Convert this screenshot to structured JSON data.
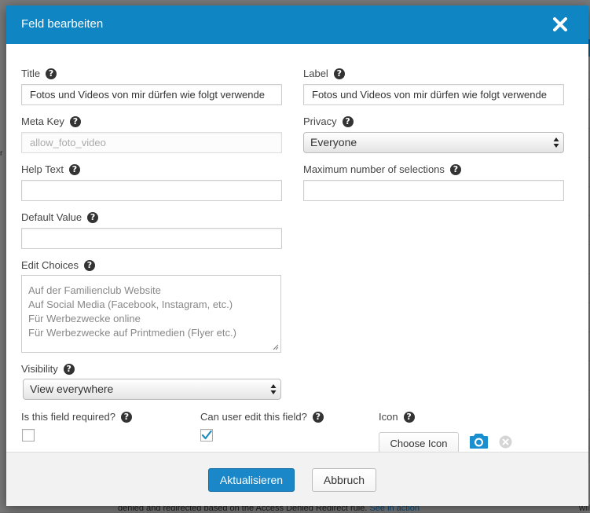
{
  "background": {
    "bottom_text": "denied and redirected based on the Access Denied Redirect rule.",
    "bottom_link": "See in action",
    "left_fragment": "r",
    "right_fragment": "will"
  },
  "modal": {
    "title": "Feld bearbeiten"
  },
  "form": {
    "title": {
      "label": "Title",
      "value": "Fotos und Videos von mir dürfen wie folgt verwende"
    },
    "label": {
      "label": "Label",
      "value": "Fotos und Videos von mir dürfen wie folgt verwende"
    },
    "meta_key": {
      "label": "Meta Key",
      "placeholder": "allow_foto_video"
    },
    "privacy": {
      "label": "Privacy",
      "selected": "Everyone"
    },
    "help_text": {
      "label": "Help Text",
      "value": ""
    },
    "max_selections": {
      "label": "Maximum number of selections",
      "value": ""
    },
    "default_value": {
      "label": "Default Value",
      "value": ""
    },
    "edit_choices": {
      "label": "Edit Choices",
      "lines": [
        "Auf der Familienclub Website",
        "Auf Social Media (Facebook, Instagram, etc.)",
        "Für Werbezwecke online",
        "Für Werbezwecke auf Printmedien (Flyer etc.)"
      ]
    },
    "visibility": {
      "label": "Visibility",
      "selected": "View everywhere"
    },
    "required": {
      "label": "Is this field required?",
      "checked": false
    },
    "editable": {
      "label": "Can user edit this field?",
      "checked": true
    },
    "icon": {
      "label": "Icon",
      "button_label": "Choose Icon"
    }
  },
  "help_glyph": "?",
  "footer": {
    "update_label": "Aktualisieren",
    "cancel_label": "Abbruch"
  },
  "colors": {
    "header": "#0f85c3",
    "primary_button": "#1a87c9",
    "checkmark": "#1e8cbe"
  },
  "icons": {
    "close": "close-icon",
    "help": "help-icon",
    "camera": "camera-icon",
    "remove": "remove-icon"
  }
}
